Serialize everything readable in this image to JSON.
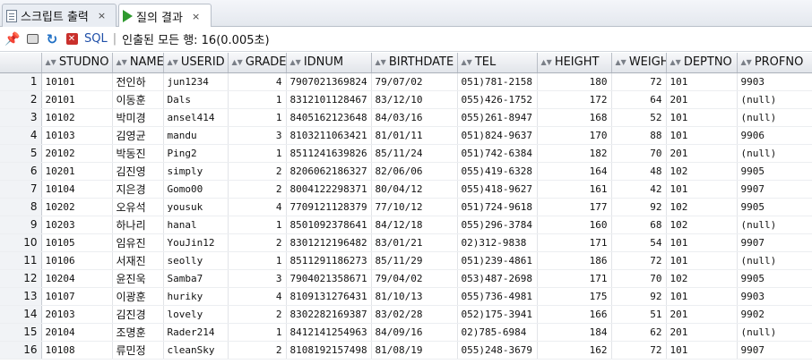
{
  "tabs": [
    {
      "label": "스크립트 출력",
      "close": "×",
      "icon": "document-icon"
    },
    {
      "label": "질의 결과",
      "close": "×",
      "icon": "run-triangle-icon"
    }
  ],
  "toolbar": {
    "sql_label": "SQL",
    "separator": "|",
    "status_text": "인출된 모든 행: 16(0.005초)"
  },
  "columns": [
    "STUDNO",
    "NAME",
    "USERID",
    "GRADE",
    "IDNUM",
    "BIRTHDATE",
    "TEL",
    "HEIGHT",
    "WEIGHT",
    "DEPTNO",
    "PROFNO"
  ],
  "rows": [
    {
      "rn": "1",
      "studno": "10101",
      "name": "전인하",
      "userid": "jun1234",
      "grade": "4",
      "idnum": "7907021369824",
      "birthdate": "79/07/02",
      "tel": "051)781-2158",
      "height": "180",
      "weight": "72",
      "deptno": "101",
      "profno": "9903"
    },
    {
      "rn": "2",
      "studno": "20101",
      "name": "이동훈",
      "userid": "Dals",
      "grade": "1",
      "idnum": "8312101128467",
      "birthdate": "83/12/10",
      "tel": "055)426-1752",
      "height": "172",
      "weight": "64",
      "deptno": "201",
      "profno": "(null)"
    },
    {
      "rn": "3",
      "studno": "10102",
      "name": "박미경",
      "userid": "ansel414",
      "grade": "1",
      "idnum": "8405162123648",
      "birthdate": "84/03/16",
      "tel": "055)261-8947",
      "height": "168",
      "weight": "52",
      "deptno": "101",
      "profno": "(null)"
    },
    {
      "rn": "4",
      "studno": "10103",
      "name": "김영균",
      "userid": "mandu",
      "grade": "3",
      "idnum": "8103211063421",
      "birthdate": "81/01/11",
      "tel": "051)824-9637",
      "height": "170",
      "weight": "88",
      "deptno": "101",
      "profno": "9906"
    },
    {
      "rn": "5",
      "studno": "20102",
      "name": "박동진",
      "userid": "Ping2",
      "grade": "1",
      "idnum": "8511241639826",
      "birthdate": "85/11/24",
      "tel": "051)742-6384",
      "height": "182",
      "weight": "70",
      "deptno": "201",
      "profno": "(null)"
    },
    {
      "rn": "6",
      "studno": "10201",
      "name": "김진영",
      "userid": "simply",
      "grade": "2",
      "idnum": "8206062186327",
      "birthdate": "82/06/06",
      "tel": "055)419-6328",
      "height": "164",
      "weight": "48",
      "deptno": "102",
      "profno": "9905"
    },
    {
      "rn": "7",
      "studno": "10104",
      "name": "지은경",
      "userid": "Gomo00",
      "grade": "2",
      "idnum": "8004122298371",
      "birthdate": "80/04/12",
      "tel": "055)418-9627",
      "height": "161",
      "weight": "42",
      "deptno": "101",
      "profno": "9907"
    },
    {
      "rn": "8",
      "studno": "10202",
      "name": "오유석",
      "userid": "yousuk",
      "grade": "4",
      "idnum": "7709121128379",
      "birthdate": "77/10/12",
      "tel": "051)724-9618",
      "height": "177",
      "weight": "92",
      "deptno": "102",
      "profno": "9905"
    },
    {
      "rn": "9",
      "studno": "10203",
      "name": "하나리",
      "userid": "hanal",
      "grade": "1",
      "idnum": "8501092378641",
      "birthdate": "84/12/18",
      "tel": "055)296-3784",
      "height": "160",
      "weight": "68",
      "deptno": "102",
      "profno": "(null)"
    },
    {
      "rn": "10",
      "studno": "10105",
      "name": "임유진",
      "userid": "YouJin12",
      "grade": "2",
      "idnum": "8301212196482",
      "birthdate": "83/01/21",
      "tel": "02)312-9838",
      "height": "171",
      "weight": "54",
      "deptno": "101",
      "profno": "9907"
    },
    {
      "rn": "11",
      "studno": "10106",
      "name": "서재진",
      "userid": "seolly",
      "grade": "1",
      "idnum": "8511291186273",
      "birthdate": "85/11/29",
      "tel": "051)239-4861",
      "height": "186",
      "weight": "72",
      "deptno": "101",
      "profno": "(null)"
    },
    {
      "rn": "12",
      "studno": "10204",
      "name": "윤진욱",
      "userid": "Samba7",
      "grade": "3",
      "idnum": "7904021358671",
      "birthdate": "79/04/02",
      "tel": "053)487-2698",
      "height": "171",
      "weight": "70",
      "deptno": "102",
      "profno": "9905"
    },
    {
      "rn": "13",
      "studno": "10107",
      "name": "이광훈",
      "userid": "huriky",
      "grade": "4",
      "idnum": "8109131276431",
      "birthdate": "81/10/13",
      "tel": "055)736-4981",
      "height": "175",
      "weight": "92",
      "deptno": "101",
      "profno": "9903"
    },
    {
      "rn": "14",
      "studno": "20103",
      "name": "김진경",
      "userid": "lovely",
      "grade": "2",
      "idnum": "8302282169387",
      "birthdate": "83/02/28",
      "tel": "052)175-3941",
      "height": "166",
      "weight": "51",
      "deptno": "201",
      "profno": "9902"
    },
    {
      "rn": "15",
      "studno": "20104",
      "name": "조명훈",
      "userid": "Rader214",
      "grade": "1",
      "idnum": "8412141254963",
      "birthdate": "84/09/16",
      "tel": "02)785-6984",
      "height": "184",
      "weight": "62",
      "deptno": "201",
      "profno": "(null)"
    },
    {
      "rn": "16",
      "studno": "10108",
      "name": "류민정",
      "userid": "cleanSky",
      "grade": "2",
      "idnum": "8108192157498",
      "birthdate": "81/08/19",
      "tel": "055)248-3679",
      "height": "162",
      "weight": "72",
      "deptno": "101",
      "profno": "9907"
    }
  ]
}
